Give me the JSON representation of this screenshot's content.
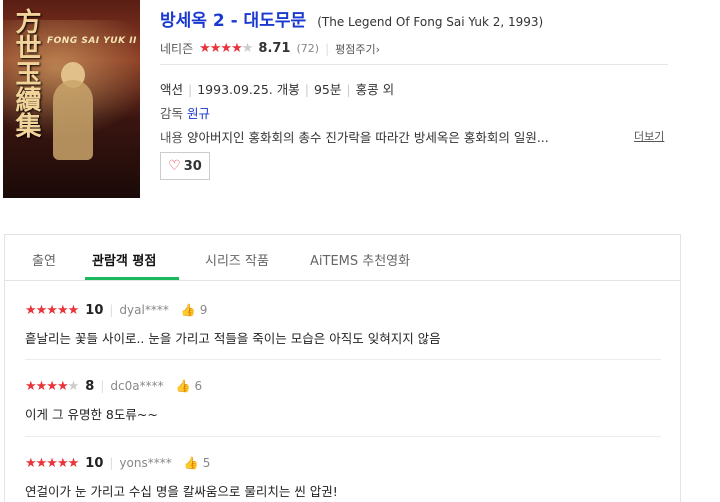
{
  "movie": {
    "poster_title_art": "方世玉續集",
    "poster_en": "FONG SAI YUK II",
    "title": "방세옥 2 - 대도무문",
    "subtitle": "(The Legend Of Fong Sai Yuk 2, 1993)",
    "netizen_label": "네티즌",
    "score": "8.71",
    "rating_count": "(72)",
    "rate_link": "평점주기",
    "genre": "액션",
    "release": "1993.09.25. 개봉",
    "runtime": "95분",
    "country": "홍콩 외",
    "director_label": "감독",
    "director": "원규",
    "synopsis_label": "내용",
    "synopsis": "양아버지인 홍화회의 총수 진가락을 따라간 방세옥은 홍화회의 일원...",
    "more_link": "더보기",
    "like_count": "30"
  },
  "tabs": [
    {
      "label": "출연"
    },
    {
      "label": "관람객 평점"
    },
    {
      "label": "시리즈 작품"
    },
    {
      "label": "AiTEMS 추천영화"
    }
  ],
  "reviews": [
    {
      "score": "10",
      "user": "dyal****",
      "likes": "9",
      "text": "흩날리는 꽃들 사이로.. 눈을 가리고 적들을 죽이는 모습은 아직도 잊혀지지 않음"
    },
    {
      "score": "8",
      "user": "dc0a****",
      "likes": "6",
      "text": "이게 그 유명한 8도류~~"
    },
    {
      "score": "10",
      "user": "yons****",
      "likes": "5",
      "text": "연걸이가 눈 가리고 수십 명을 칼싸움으로 물리치는 씬 압권!"
    }
  ],
  "colors": {
    "star": "#e8343a",
    "title": "#1a3acf",
    "tab_accent": "#1ab85c"
  },
  "icons": {
    "heart": "heart-icon",
    "thumb": "thumbs-up-icon",
    "chevron": "chevron-right-icon"
  }
}
